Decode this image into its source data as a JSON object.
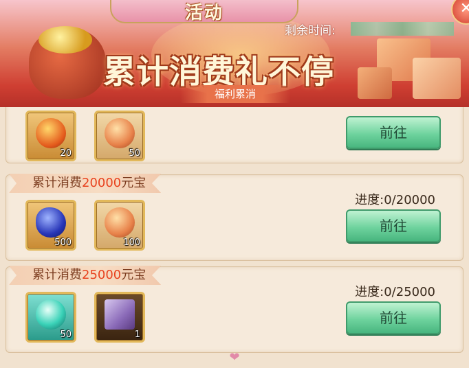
{
  "header": {
    "tab_title": "活动",
    "remaining_label": "剩余时间:",
    "banner_title": "累计消费礼不停",
    "subtitle": "福利累消",
    "close_icon": "close-icon"
  },
  "tiers": [
    {
      "label": "",
      "amount": "",
      "unit": "",
      "progress": "",
      "button": "前往",
      "items": [
        {
          "icon": "fire-orb-icon",
          "count": "20"
        },
        {
          "icon": "amber-orb-icon",
          "count": "50"
        }
      ]
    },
    {
      "label": "累计消费",
      "amount": "20000",
      "unit": "元宝",
      "progress": "进度:0/20000",
      "button": "前往",
      "items": [
        {
          "icon": "sapphire-gem-icon",
          "count": "500"
        },
        {
          "icon": "amber-orb-icon",
          "count": "100"
        }
      ]
    },
    {
      "label": "累计消费",
      "amount": "25000",
      "unit": "元宝",
      "progress": "进度:0/25000",
      "button": "前往",
      "items": [
        {
          "icon": "jade-orb-icon",
          "count": "50"
        },
        {
          "icon": "gift-box-icon",
          "count": "1"
        }
      ]
    }
  ],
  "colors": {
    "accent": "#e8421e",
    "button": "#6fd39e",
    "panel": "#f6eadb"
  }
}
